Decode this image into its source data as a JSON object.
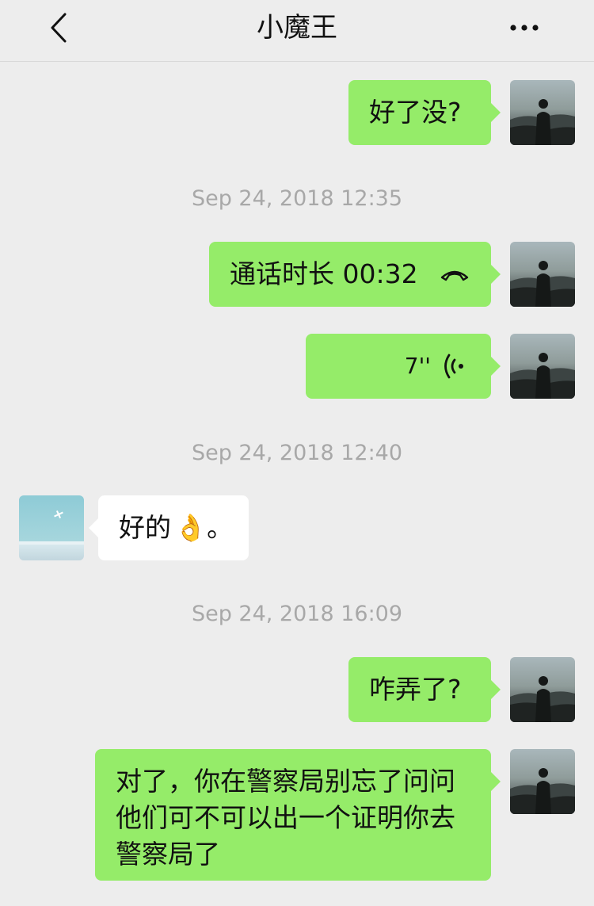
{
  "header": {
    "title": "小魔王",
    "back_icon": "chevron-left-icon",
    "more_icon": "more-dots-icon"
  },
  "colors": {
    "background": "#ededed",
    "self_bubble": "#95ec69",
    "other_bubble": "#ffffff",
    "timestamp_text": "#a8a8a8"
  },
  "messages": {
    "m1": {
      "text": "好了没?"
    },
    "t1": "Sep 24, 2018 12:35",
    "m2": {
      "text": "通话时长 00:32",
      "icon": "phone-hangup-icon"
    },
    "m3": {
      "text": "7''",
      "icon": "voice-wave-icon"
    },
    "t2": "Sep 24, 2018 12:40",
    "m4": {
      "text": "好的",
      "emoji": "👌",
      "suffix": "。"
    },
    "t3": "Sep 24, 2018 16:09",
    "m5": {
      "text": "咋弄了?"
    },
    "m6": {
      "lines": [
        "对了，你在警察局别忘了问问",
        "他们可不可以出一个证明你去",
        "警察局了"
      ]
    }
  }
}
